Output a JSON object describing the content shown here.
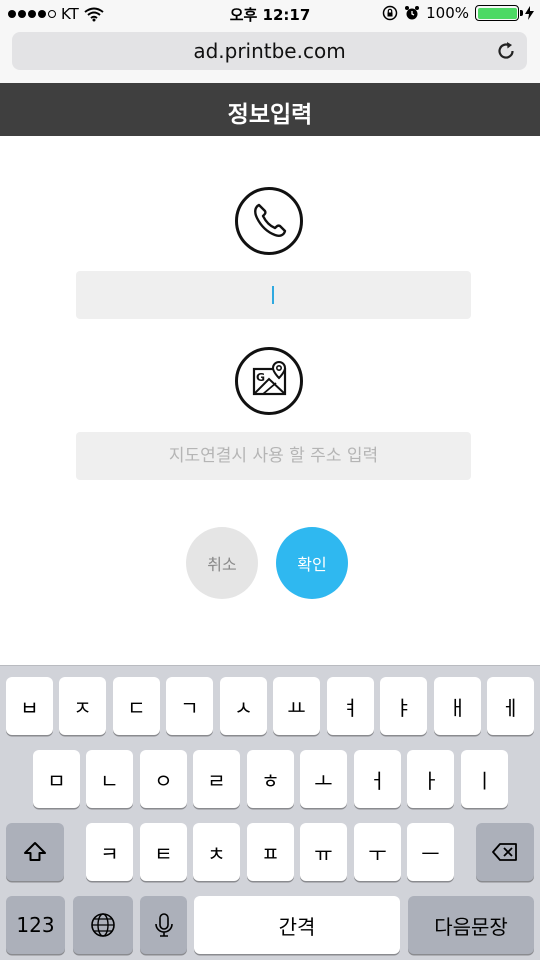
{
  "status_bar": {
    "carrier": "KT",
    "time": "오후 12:17",
    "battery_percent": "100%",
    "battery_level": 1.0,
    "signal_bars": 4,
    "signal_total": 5,
    "icons": [
      "wifi-icon",
      "orientation-lock-icon",
      "alarm-icon",
      "charging-bolt-icon"
    ]
  },
  "browser": {
    "url": "ad.printbe.com",
    "reload_icon": "reload-icon"
  },
  "header": {
    "title": "정보입력"
  },
  "form": {
    "phone_icon": "phone-icon",
    "phone_value": "",
    "phone_placeholder": "",
    "map_icon": "map-location-icon",
    "address_value": "",
    "address_placeholder": "지도연결시 사용 할 주소 입력",
    "cancel_label": "취소",
    "confirm_label": "확인",
    "accent_color": "#2fb8f0"
  },
  "keyboard": {
    "row1": [
      "ㅂ",
      "ㅈ",
      "ㄷ",
      "ㄱ",
      "ㅅ",
      "ㅛ",
      "ㅕ",
      "ㅑ",
      "ㅐ",
      "ㅔ"
    ],
    "row2": [
      "ㅁ",
      "ㄴ",
      "ㅇ",
      "ㄹ",
      "ㅎ",
      "ㅗ",
      "ㅓ",
      "ㅏ",
      "ㅣ"
    ],
    "row3": [
      "ㅋ",
      "ㅌ",
      "ㅊ",
      "ㅍ",
      "ㅠ",
      "ㅜ",
      "ㅡ"
    ],
    "numbers_label": "123",
    "space_label": "간격",
    "return_label": "다음문장",
    "shift_icon": "shift-icon",
    "delete_icon": "backspace-icon",
    "globe_icon": "globe-icon",
    "mic_icon": "microphone-icon"
  }
}
